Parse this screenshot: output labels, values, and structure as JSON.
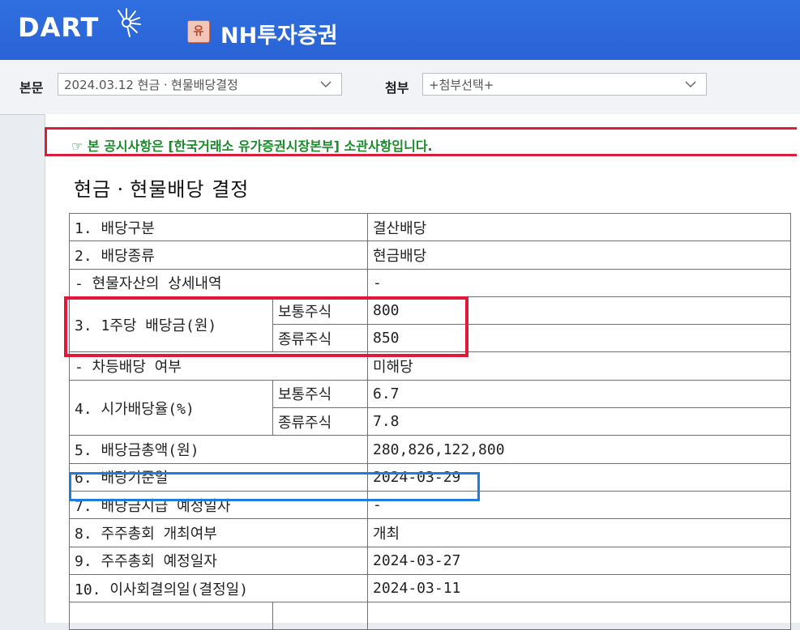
{
  "header": {
    "logo_text": "DART",
    "company_badge": "유",
    "company_name": "NH투자증권",
    "colors": {
      "bar": "#2a63d6",
      "badge_bg": "#f2c6b8"
    }
  },
  "toolbar": {
    "main_label": "본문",
    "main_select_value": "2024.03.12  현금ㆍ현물배당결정",
    "attach_label": "첨부",
    "attach_select_value": "+첨부선택+"
  },
  "notice": {
    "icon": "pointing-hand-icon",
    "text": "☞ 본 공시사항은 [한국거래소 유가증권시장본부] 소관사항입니다."
  },
  "document": {
    "title": "현금ㆍ현물배당 결정",
    "rows": {
      "r1_label": "1. 배당구분",
      "r1_value": "결산배당",
      "r2_label": "2. 배당종류",
      "r2_value": "현금배당",
      "r3_label": "- 현물자산의 상세내역",
      "r3_value": "-",
      "r4_label": "3. 1주당 배당금(원)",
      "r4_sub1": "보통주식",
      "r4_val1": "800",
      "r4_sub2": "종류주식",
      "r4_val2": "850",
      "r5_label": "- 차등배당 여부",
      "r5_value": "미해당",
      "r6_label": "4. 시가배당율(%)",
      "r6_sub1": "보통주식",
      "r6_val1": "6.7",
      "r6_sub2": "종류주식",
      "r6_val2": "7.8",
      "r7_label": "5. 배당금총액(원)",
      "r7_value": "280,826,122,800",
      "r8_label": "6. 배당기준일",
      "r8_value": "2024-03-29",
      "r9_label": "7. 배당금지급 예정일자",
      "r9_value": "-",
      "r10_label": "8. 주주총회 개최여부",
      "r10_value": "개최",
      "r11_label": "9. 주주총회 예정일자",
      "r11_value": "2024-03-27",
      "r12_label": "10. 이사회결의일(결정일)",
      "r12_value": "2024-03-11"
    }
  },
  "highlights": {
    "red": "#e3173a",
    "blue": "#1e7be0"
  }
}
